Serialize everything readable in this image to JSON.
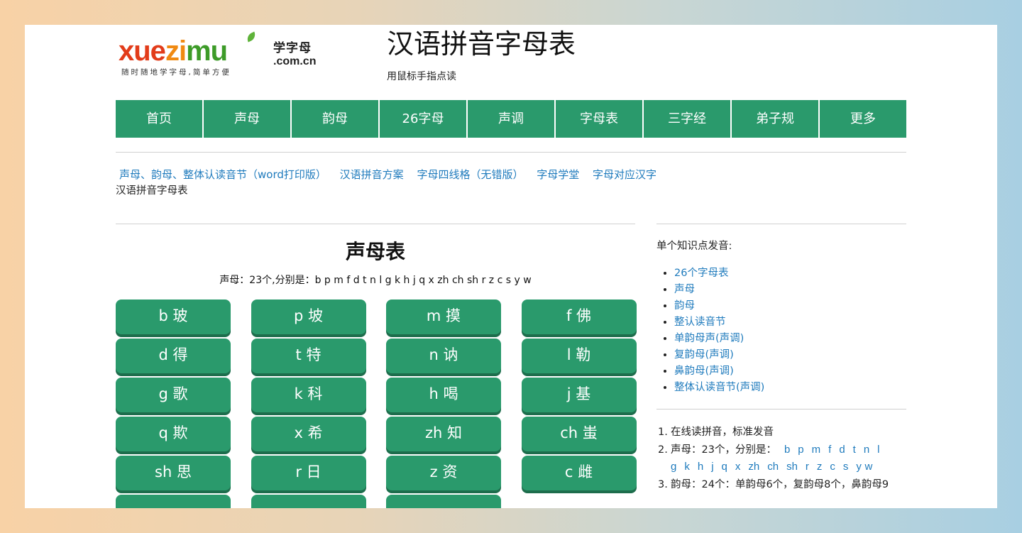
{
  "logo": {
    "red": "xue",
    "orange": "zi",
    "green": "mu",
    "cn": "学字母",
    "domain": ".com.cn",
    "tagline": "随时随地学字母,简单方便"
  },
  "header": {
    "title": "汉语拼音字母表",
    "subtitle": "用鼠标手指点读"
  },
  "nav": [
    {
      "label": "首页"
    },
    {
      "label": "声母"
    },
    {
      "label": "韵母"
    },
    {
      "label": "26字母"
    },
    {
      "label": "声调"
    },
    {
      "label": "字母表"
    },
    {
      "label": "三字经"
    },
    {
      "label": "弟子规"
    },
    {
      "label": "更多"
    }
  ],
  "links": [
    {
      "label": "声母、韵母、整体认读音节（word打印版）"
    },
    {
      "label": "汉语拼音方案"
    },
    {
      "label": "字母四线格（无错版）"
    },
    {
      "label": "字母学堂"
    },
    {
      "label": "字母对应汉字"
    }
  ],
  "breadcrumb": "汉语拼音字母表",
  "main": {
    "title": "声母表",
    "desc": "声母：23个,分别是：b p m f d t n l g k h j q x zh ch sh r z c s y w",
    "keys": [
      {
        "label": "b 玻"
      },
      {
        "label": "p 坡"
      },
      {
        "label": "m 摸"
      },
      {
        "label": "f 佛"
      },
      {
        "label": "d 得"
      },
      {
        "label": "t 特"
      },
      {
        "label": "n 讷"
      },
      {
        "label": "l 勒"
      },
      {
        "label": "g 歌"
      },
      {
        "label": "k 科"
      },
      {
        "label": "h 喝"
      },
      {
        "label": "j 基"
      },
      {
        "label": "q 欺"
      },
      {
        "label": "x 希"
      },
      {
        "label": "zh 知"
      },
      {
        "label": "ch 蚩"
      },
      {
        "label": "sh 思"
      },
      {
        "label": "r 日"
      },
      {
        "label": "z 资"
      },
      {
        "label": "c 雌"
      }
    ]
  },
  "sidebar": {
    "heading": "单个知识点发音:",
    "items": [
      {
        "label": "26个字母表"
      },
      {
        "label": "声母"
      },
      {
        "label": "韵母"
      },
      {
        "label": "整认读音节"
      },
      {
        "label": "单韵母声(声调)"
      },
      {
        "label": "复韵母(声调)"
      },
      {
        "label": "鼻韵母(声调)"
      },
      {
        "label": "整体认读音节(声调)"
      }
    ],
    "notes": {
      "n1": "1.",
      "t1": "在线读拼音，标准发音",
      "n2": "2.",
      "t2": "声母：23个，分别是：",
      "letters": [
        "b",
        "p",
        "m",
        "f",
        "d",
        "t",
        "n",
        "l",
        "g",
        "k",
        "h",
        "j",
        "q",
        "x",
        "zh",
        "ch",
        "sh",
        "r",
        "z",
        "c",
        "s",
        "y",
        "w"
      ],
      "n3": "3.",
      "t3": "韵母：24个：单韵母6个，复韵母8个，鼻韵母9"
    }
  },
  "colors": {
    "accent": "#2a9a6c",
    "link": "#1f7bbd"
  }
}
